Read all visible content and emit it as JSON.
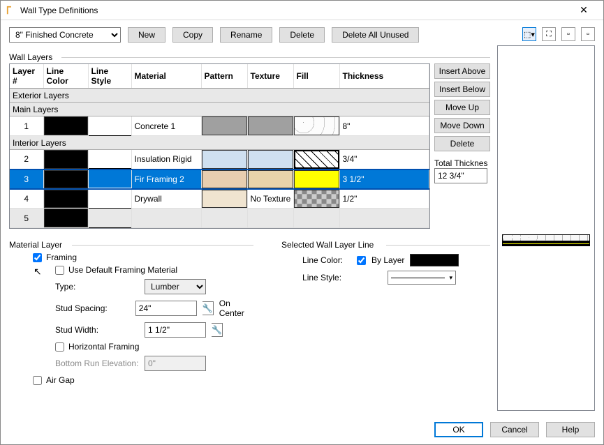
{
  "title": "Wall Type Definitions",
  "wall_type_selected": "8\" Finished Concrete",
  "topbar": {
    "new": "New",
    "copy": "Copy",
    "rename": "Rename",
    "delete": "Delete",
    "deleteUnused": "Delete All Unused"
  },
  "group_labels": {
    "wall_layers": "Wall Layers",
    "material_layer": "Material Layer",
    "selected_line": "Selected Wall Layer Line"
  },
  "headers": {
    "layer": "Layer #",
    "linecolor": "Line Color",
    "linestyle": "Line Style",
    "material": "Material",
    "pattern": "Pattern",
    "texture": "Texture",
    "fill": "Fill",
    "thickness": "Thickness"
  },
  "sections": {
    "exterior": "Exterior Layers",
    "main": "Main Layers",
    "interior": "Interior Layers"
  },
  "rows": [
    {
      "n": "1",
      "material": "Concrete 1",
      "thickness": "8\""
    },
    {
      "n": "2",
      "material": "Insulation Rigid",
      "thickness": "3/4\""
    },
    {
      "n": "3",
      "material": "Fir Framing 2",
      "thickness": "3 1/2\""
    },
    {
      "n": "4",
      "material": "Drywall",
      "texture": "No Texture",
      "thickness": "1/2\""
    },
    {
      "n": "5",
      "material": "",
      "thickness": ""
    }
  ],
  "sidebtns": {
    "ia": "Insert Above",
    "ib": "Insert Below",
    "mu": "Move Up",
    "md": "Move Down",
    "del": "Delete"
  },
  "total": {
    "label": "Total Thicknes",
    "value": "12 3/4\""
  },
  "material": {
    "framing": "Framing",
    "useDefault": "Use Default Framing Material",
    "type_l": "Type:",
    "type_v": "Lumber",
    "spacing_l": "Stud Spacing:",
    "spacing_v": "24\"",
    "oncenter": "On Center",
    "width_l": "Stud Width:",
    "width_v": "1 1/2\"",
    "horiz": "Horizontal Framing",
    "bottom_l": "Bottom Run Elevation:",
    "bottom_v": "0\"",
    "airgap": "Air Gap"
  },
  "line_panel": {
    "color_l": "Line Color:",
    "bylayer": "By Layer",
    "style_l": "Line Style:"
  },
  "footer": {
    "ok": "OK",
    "cancel": "Cancel",
    "help": "Help"
  }
}
